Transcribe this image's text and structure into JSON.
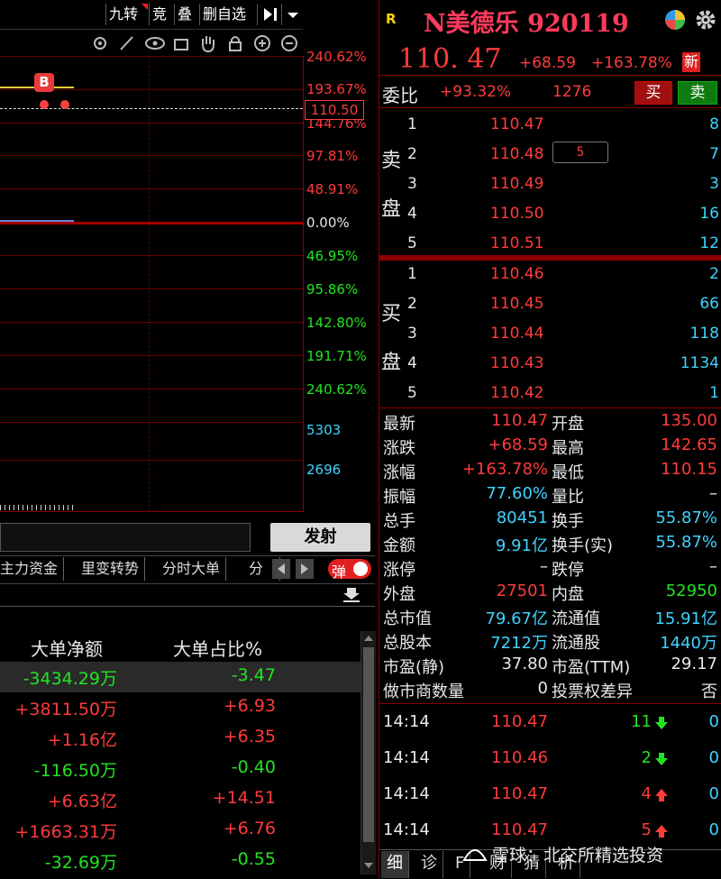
{
  "toolbar": {
    "jiuzhuan": "九转",
    "jing": "竞",
    "die": "叠",
    "del_watch": "删自选"
  },
  "chart": {
    "price_tag": "110.50",
    "b_marker": "B",
    "up_labels": [
      "240.62%",
      "193.67%",
      "144.76%",
      "97.81%",
      "48.91%"
    ],
    "zero_label": "0.00%",
    "down_labels": [
      "46.95%",
      "95.86%",
      "142.80%",
      "191.71%",
      "240.62%"
    ],
    "vol_labels": [
      "5303",
      "2696"
    ]
  },
  "send": {
    "button": "发射"
  },
  "tabs": [
    "主力资金",
    "里变转势",
    "分时大单",
    "分时"
  ],
  "danmu": {
    "label": "弹"
  },
  "big_order": {
    "headers": [
      "大单净额",
      "大单占比%"
    ],
    "rows": [
      {
        "net": "-3434.29万",
        "ratio": "-3.47",
        "net_color": "#22e322",
        "ratio_color": "#22e322"
      },
      {
        "net": "+3811.50万",
        "ratio": "+6.93",
        "net_color": "#ff3b3b",
        "ratio_color": "#ff3b3b"
      },
      {
        "net": "+1.16亿",
        "ratio": "+6.35",
        "net_color": "#ff3b3b",
        "ratio_color": "#ff3b3b"
      },
      {
        "net": "-116.50万",
        "ratio": "-0.40",
        "net_color": "#22e322",
        "ratio_color": "#22e322"
      },
      {
        "net": "+6.63亿",
        "ratio": "+14.51",
        "net_color": "#ff3b3b",
        "ratio_color": "#ff3b3b"
      },
      {
        "net": "+1663.31万",
        "ratio": "+6.76",
        "net_color": "#ff3b3b",
        "ratio_color": "#ff3b3b"
      },
      {
        "net": "-32.69万",
        "ratio": "-0.55",
        "net_color": "#22e322",
        "ratio_color": "#22e322"
      }
    ]
  },
  "stock": {
    "flag": "R",
    "title": "N美德乐 920119",
    "price": "110. 47",
    "change": "+68.59",
    "pct": "+163.78%",
    "new_badge": "新",
    "weibi_label": "委比",
    "weibi": "+93.32%",
    "weicha": "1276",
    "buy_btn": "买",
    "sell_btn": "卖"
  },
  "orderbook": {
    "sell_label": [
      "卖",
      "盘"
    ],
    "buy_label": [
      "买",
      "盘"
    ],
    "sell": [
      {
        "lvl": "5",
        "price": "110.51",
        "qty": "12"
      },
      {
        "lvl": "4",
        "price": "110.50",
        "qty": "16",
        "mine": "5"
      },
      {
        "lvl": "3",
        "price": "110.49",
        "qty": "3"
      },
      {
        "lvl": "2",
        "price": "110.48",
        "qty": "7"
      },
      {
        "lvl": "1",
        "price": "110.47",
        "qty": "8"
      }
    ],
    "buy": [
      {
        "lvl": "1",
        "price": "110.46",
        "qty": "2"
      },
      {
        "lvl": "2",
        "price": "110.45",
        "qty": "66"
      },
      {
        "lvl": "3",
        "price": "110.44",
        "qty": "118"
      },
      {
        "lvl": "4",
        "price": "110.43",
        "qty": "1134"
      },
      {
        "lvl": "5",
        "price": "110.42",
        "qty": "1"
      }
    ]
  },
  "quote": [
    {
      "l1": "最新",
      "v1": "110.47",
      "c1": "#ff3b3b",
      "l2": "开盘",
      "v2": "135.00",
      "c2": "#ff3b3b"
    },
    {
      "l1": "涨跌",
      "v1": "+68.59",
      "c1": "#ff3b3b",
      "l2": "最高",
      "v2": "142.65",
      "c2": "#ff3b3b"
    },
    {
      "l1": "涨幅",
      "v1": "+163.78%",
      "c1": "#ff3b3b",
      "l2": "最低",
      "v2": "110.15",
      "c2": "#ff3b3b"
    },
    {
      "l1": "振幅",
      "v1": "77.60%",
      "c1": "#3fd3ff",
      "l2": "量比",
      "v2": "–",
      "c2": "#e8e8e8"
    },
    {
      "l1": "总手",
      "v1": "80451",
      "c1": "#3fd3ff",
      "l2": "换手",
      "v2": "55.87%",
      "c2": "#3fd3ff"
    },
    {
      "l1": "金额",
      "v1": "9.91亿",
      "c1": "#3fd3ff",
      "l2": "换手(实)",
      "v2": "55.87%",
      "c2": "#3fd3ff"
    },
    {
      "l1": "涨停",
      "v1": "–",
      "c1": "#e8e8e8",
      "l2": "跌停",
      "v2": "–",
      "c2": "#e8e8e8"
    },
    {
      "l1": "外盘",
      "v1": "27501",
      "c1": "#ff3b3b",
      "l2": "内盘",
      "v2": "52950",
      "c2": "#22e322"
    },
    {
      "l1": "总市值",
      "v1": "79.67亿",
      "c1": "#3fd3ff",
      "l2": "流通值",
      "v2": "15.91亿",
      "c2": "#3fd3ff"
    },
    {
      "l1": "总股本",
      "v1": "7212万",
      "c1": "#3fd3ff",
      "l2": "流通股",
      "v2": "1440万",
      "c2": "#3fd3ff"
    },
    {
      "l1": "市盈(静)",
      "v1": "37.80",
      "c1": "#e8e8e8",
      "l2": "市盈(TTM)",
      "v2": "29.17",
      "c2": "#e8e8e8"
    },
    {
      "l1": "做市商数量",
      "v1": "0",
      "c1": "#e8e8e8",
      "l2": "投票权差异",
      "v2": "否",
      "c2": "#e8e8e8"
    }
  ],
  "ticks": [
    {
      "time": "14:14",
      "price": "110.47",
      "vol": "11",
      "dir": "down",
      "n": "0"
    },
    {
      "time": "14:14",
      "price": "110.46",
      "vol": "2",
      "dir": "down",
      "n": "0"
    },
    {
      "time": "14:14",
      "price": "110.47",
      "vol": "4",
      "dir": "up",
      "n": "0"
    },
    {
      "time": "14:14",
      "price": "110.47",
      "vol": "5",
      "dir": "up",
      "n": "0"
    }
  ],
  "bottom_tabs": [
    "细",
    "诊",
    "F",
    "财",
    "猜",
    "析"
  ],
  "watermark": "雪球：北交所精选投资"
}
